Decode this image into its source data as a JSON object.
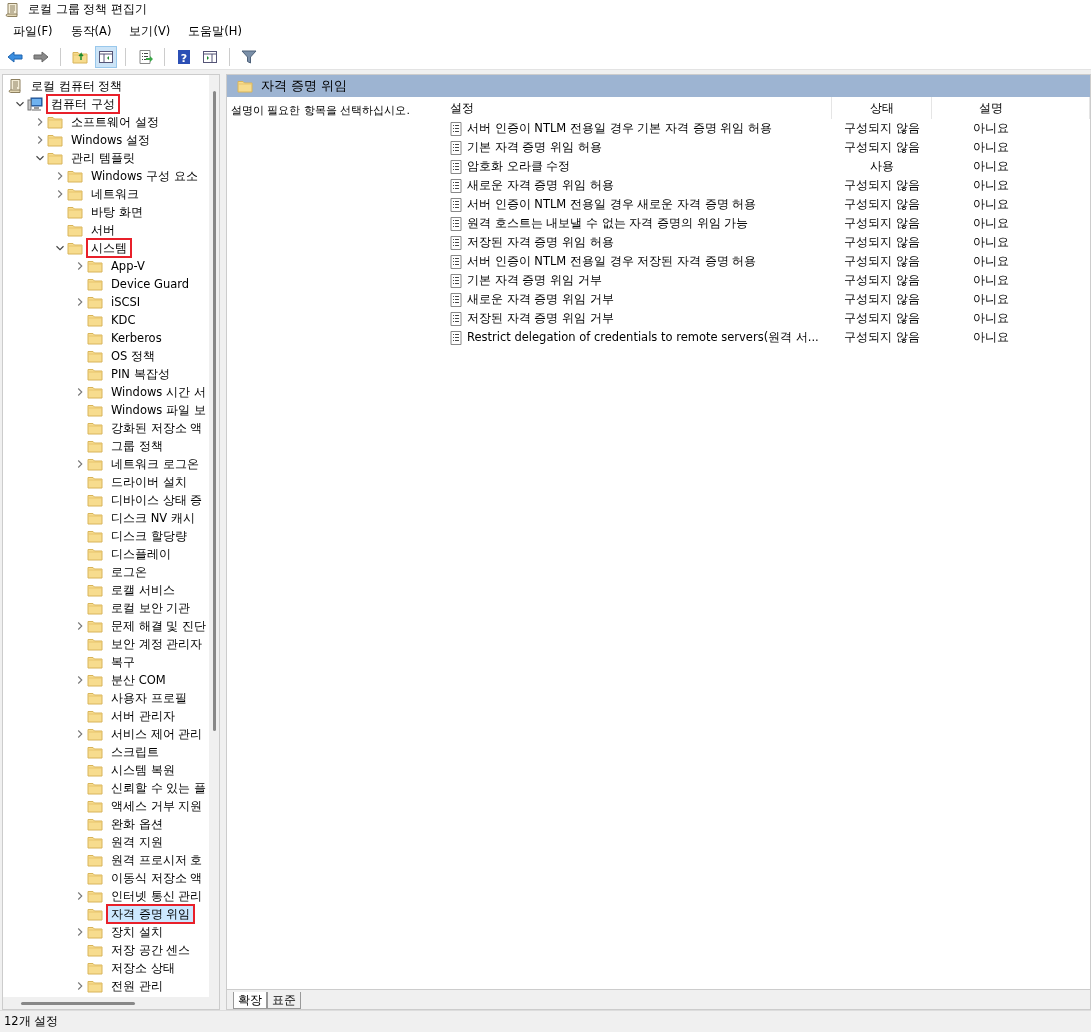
{
  "window": {
    "title": "로컬 그룹 정책 편집기"
  },
  "menu": [
    "파일(F)",
    "동작(A)",
    "보기(V)",
    "도움말(H)"
  ],
  "toolbar": [
    {
      "kind": "back",
      "pressed": false
    },
    {
      "kind": "forward",
      "pressed": false
    },
    {
      "kind": "sep"
    },
    {
      "kind": "up",
      "pressed": false
    },
    {
      "kind": "tree",
      "pressed": true
    },
    {
      "kind": "sep"
    },
    {
      "kind": "export",
      "pressed": false
    },
    {
      "kind": "sep"
    },
    {
      "kind": "help",
      "pressed": false,
      "glyph": "?"
    },
    {
      "kind": "pane",
      "pressed": false
    },
    {
      "kind": "sep"
    },
    {
      "kind": "filter",
      "pressed": false
    }
  ],
  "tree": [
    {
      "label": "로컬 컴퓨터 정책",
      "kind": "policy",
      "selected": false,
      "highlighted": false,
      "children": [
        {
          "label": "컴퓨터 구성",
          "kind": "computer",
          "expanded": true,
          "selected": false,
          "highlighted": true,
          "children": [
            {
              "label": "소프트웨어 설정",
              "kind": "folder",
              "expanded": false,
              "selected": false,
              "highlighted": false
            },
            {
              "label": "Windows 설정",
              "kind": "folder",
              "expanded": false,
              "selected": false,
              "highlighted": false
            },
            {
              "label": "관리 템플릿",
              "kind": "folder",
              "expanded": true,
              "selected": false,
              "highlighted": false,
              "children": [
                {
                  "label": "Windows 구성 요소",
                  "kind": "folder",
                  "expanded": false,
                  "selected": false,
                  "highlighted": false
                },
                {
                  "label": "네트워크",
                  "kind": "folder",
                  "expanded": false,
                  "selected": false,
                  "highlighted": false
                },
                {
                  "label": "바탕 화면",
                  "kind": "folder",
                  "selected": false,
                  "highlighted": false
                },
                {
                  "label": "서버",
                  "kind": "folder",
                  "selected": false,
                  "highlighted": false
                },
                {
                  "label": "시스템",
                  "kind": "folder",
                  "expanded": true,
                  "selected": false,
                  "highlighted": true,
                  "children": [
                    {
                      "label": "App-V",
                      "kind": "folder",
                      "expanded": false,
                      "selected": false,
                      "highlighted": false
                    },
                    {
                      "label": "Device Guard",
                      "kind": "folder",
                      "selected": false,
                      "highlighted": false
                    },
                    {
                      "label": "iSCSI",
                      "kind": "folder",
                      "expanded": false,
                      "selected": false,
                      "highlighted": false
                    },
                    {
                      "label": "KDC",
                      "kind": "folder",
                      "selected": false,
                      "highlighted": false
                    },
                    {
                      "label": "Kerberos",
                      "kind": "folder",
                      "selected": false,
                      "highlighted": false
                    },
                    {
                      "label": "OS 정책",
                      "kind": "folder",
                      "selected": false,
                      "highlighted": false
                    },
                    {
                      "label": "PIN 복잡성",
                      "kind": "folder",
                      "selected": false,
                      "highlighted": false
                    },
                    {
                      "label": "Windows 시간 서",
                      "kind": "folder",
                      "expanded": false,
                      "selected": false,
                      "highlighted": false
                    },
                    {
                      "label": "Windows 파일 보",
                      "kind": "folder",
                      "selected": false,
                      "highlighted": false
                    },
                    {
                      "label": "강화된 저장소 액",
                      "kind": "folder",
                      "selected": false,
                      "highlighted": false
                    },
                    {
                      "label": "그룹 정책",
                      "kind": "folder",
                      "selected": false,
                      "highlighted": false
                    },
                    {
                      "label": "네트워크 로그온",
                      "kind": "folder",
                      "expanded": false,
                      "selected": false,
                      "highlighted": false
                    },
                    {
                      "label": "드라이버 설치",
                      "kind": "folder",
                      "selected": false,
                      "highlighted": false
                    },
                    {
                      "label": "디바이스 상태 증",
                      "kind": "folder",
                      "selected": false,
                      "highlighted": false
                    },
                    {
                      "label": "디스크 NV 캐시",
                      "kind": "folder",
                      "selected": false,
                      "highlighted": false
                    },
                    {
                      "label": "디스크 할당량",
                      "kind": "folder",
                      "selected": false,
                      "highlighted": false
                    },
                    {
                      "label": "디스플레이",
                      "kind": "folder",
                      "selected": false,
                      "highlighted": false
                    },
                    {
                      "label": "로그온",
                      "kind": "folder",
                      "selected": false,
                      "highlighted": false
                    },
                    {
                      "label": "로캘 서비스",
                      "kind": "folder",
                      "selected": false,
                      "highlighted": false
                    },
                    {
                      "label": "로컬 보안 기관",
                      "kind": "folder",
                      "selected": false,
                      "highlighted": false
                    },
                    {
                      "label": "문제 해결 및 진단",
                      "kind": "folder",
                      "expanded": false,
                      "selected": false,
                      "highlighted": false
                    },
                    {
                      "label": "보안 계정 관리자",
                      "kind": "folder",
                      "selected": false,
                      "highlighted": false
                    },
                    {
                      "label": "복구",
                      "kind": "folder",
                      "selected": false,
                      "highlighted": false
                    },
                    {
                      "label": "분산 COM",
                      "kind": "folder",
                      "expanded": false,
                      "selected": false,
                      "highlighted": false
                    },
                    {
                      "label": "사용자 프로필",
                      "kind": "folder",
                      "selected": false,
                      "highlighted": false
                    },
                    {
                      "label": "서버 관리자",
                      "kind": "folder",
                      "selected": false,
                      "highlighted": false
                    },
                    {
                      "label": "서비스 제어 관리",
                      "kind": "folder",
                      "expanded": false,
                      "selected": false,
                      "highlighted": false
                    },
                    {
                      "label": "스크립트",
                      "kind": "folder",
                      "selected": false,
                      "highlighted": false
                    },
                    {
                      "label": "시스템 복원",
                      "kind": "folder",
                      "selected": false,
                      "highlighted": false
                    },
                    {
                      "label": "신뢰할 수 있는 플",
                      "kind": "folder",
                      "selected": false,
                      "highlighted": false
                    },
                    {
                      "label": "액세스 거부 지원",
                      "kind": "folder",
                      "selected": false,
                      "highlighted": false
                    },
                    {
                      "label": "완화 옵션",
                      "kind": "folder",
                      "selected": false,
                      "highlighted": false
                    },
                    {
                      "label": "원격 지원",
                      "kind": "folder",
                      "selected": false,
                      "highlighted": false
                    },
                    {
                      "label": "원격 프로시저 호",
                      "kind": "folder",
                      "selected": false,
                      "highlighted": false
                    },
                    {
                      "label": "이동식 저장소 액",
                      "kind": "folder",
                      "selected": false,
                      "highlighted": false
                    },
                    {
                      "label": "인터넷 통신 관리",
                      "kind": "folder",
                      "expanded": false,
                      "selected": false,
                      "highlighted": false
                    },
                    {
                      "label": "자격 증명 위임",
                      "kind": "folder",
                      "selected": true,
                      "highlighted": true
                    },
                    {
                      "label": "장치 설치",
                      "kind": "folder",
                      "expanded": false,
                      "selected": false,
                      "highlighted": false
                    },
                    {
                      "label": "저장 공간 센스",
                      "kind": "folder",
                      "selected": false,
                      "highlighted": false
                    },
                    {
                      "label": "저장소 상태",
                      "kind": "folder",
                      "selected": false,
                      "highlighted": false
                    },
                    {
                      "label": "전원 관리",
                      "kind": "folder",
                      "expanded": false,
                      "selected": false,
                      "highlighted": false
                    }
                  ]
                }
              ]
            }
          ]
        }
      ]
    }
  ],
  "details": {
    "header": "자격 증명 위임",
    "description": "설명이 필요한 항목을 선택하십시오.",
    "columns": [
      "설정",
      "상태",
      "설명"
    ],
    "rows": [
      [
        "서버 인증이 NTLM 전용일 경우 기본 자격 증명 위임 허용",
        "구성되지 않음",
        "아니요"
      ],
      [
        "기본 자격 증명 위임 허용",
        "구성되지 않음",
        "아니요"
      ],
      [
        "암호화 오라클 수정",
        "사용",
        "아니요"
      ],
      [
        "새로운 자격 증명 위임 허용",
        "구성되지 않음",
        "아니요"
      ],
      [
        "서버 인증이 NTLM 전용일 경우 새로운 자격 증명 허용",
        "구성되지 않음",
        "아니요"
      ],
      [
        "원격 호스트는 내보낼 수 없는 자격 증명의 위임 가능",
        "구성되지 않음",
        "아니요"
      ],
      [
        "저장된 자격 증명 위임 허용",
        "구성되지 않음",
        "아니요"
      ],
      [
        "서버 인증이 NTLM 전용일 경우 저장된 자격 증명 허용",
        "구성되지 않음",
        "아니요"
      ],
      [
        "기본 자격 증명 위임 거부",
        "구성되지 않음",
        "아니요"
      ],
      [
        "새로운 자격 증명 위임 거부",
        "구성되지 않음",
        "아니요"
      ],
      [
        "저장된 자격 증명 위임 거부",
        "구성되지 않음",
        "아니요"
      ],
      [
        "Restrict delegation of credentials to remote servers(원격 서...",
        "구성되지 않음",
        "아니요"
      ]
    ],
    "tabs": [
      {
        "label": "확장",
        "selected": true
      },
      {
        "label": "표준",
        "selected": false
      }
    ]
  },
  "status_bar": "12개 설정"
}
